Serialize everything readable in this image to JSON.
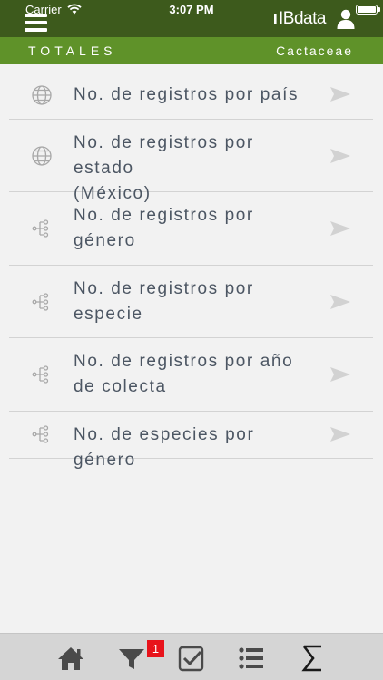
{
  "status_bar": {
    "carrier": "Carrier",
    "time": "3:07 PM"
  },
  "header": {
    "logo_text": "IBdata"
  },
  "subheader": {
    "title": "TOTALES",
    "family": "Cactaceae"
  },
  "list": {
    "items": [
      {
        "line1": "No. de registros por país",
        "line2": "",
        "icon": "globe-icon"
      },
      {
        "line1": "No. de registros por estado",
        "line2": "(México)",
        "icon": "globe-icon"
      },
      {
        "line1": "No. de registros por",
        "line2": "género",
        "icon": "tree-icon"
      },
      {
        "line1": "No. de registros por",
        "line2": "especie",
        "icon": "tree-icon"
      },
      {
        "line1": "No. de registros por año",
        "line2": "de colecta",
        "icon": "tree-icon"
      },
      {
        "line1": "No. de especies por género",
        "line2": "",
        "icon": "tree-icon"
      }
    ]
  },
  "tabbar": {
    "filter_badge": "1",
    "tabs": [
      "home-icon",
      "filter-icon",
      "checkbox-icon",
      "list-icon",
      "sigma-icon"
    ]
  },
  "colors": {
    "topbar": "#3d5a1c",
    "subbar": "#5f9229",
    "text": "#4c5663",
    "icon": "#a8a8a8",
    "badge": "#e8131b"
  }
}
